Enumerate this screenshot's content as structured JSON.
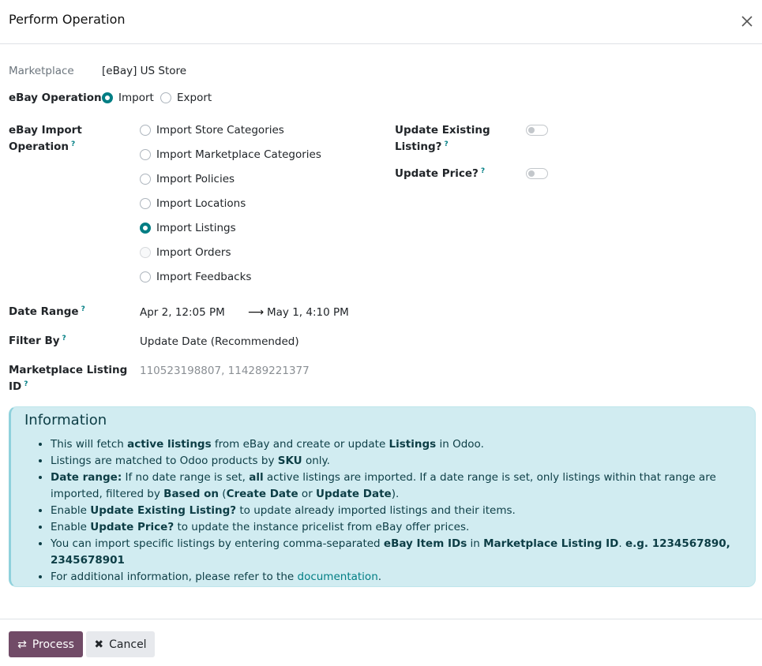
{
  "dialog": {
    "title": "Perform Operation",
    "close_icon": "close-icon"
  },
  "fields": {
    "marketplace_label": "Marketplace",
    "marketplace_value": "[eBay] US Store",
    "operation_label": "eBay Operation",
    "operation_options": [
      "Import",
      "Export"
    ],
    "operation_selected": "Import",
    "import_operation_label_line1": "eBay Import",
    "import_operation_label_line2": "Operation",
    "import_options": [
      "Import Store Categories",
      "Import Marketplace Categories",
      "Import Policies",
      "Import Locations",
      "Import Listings",
      "Import Orders",
      "Import Feedbacks"
    ],
    "import_selected": "Import Listings",
    "update_existing_label_line1": "Update Existing",
    "update_existing_label_line2": "Listing?",
    "update_existing_value": false,
    "update_price_label": "Update Price?",
    "update_price_value": false,
    "date_range_label": "Date Range",
    "date_start": "Apr 2, 12:05 PM",
    "date_end": "May 1, 4:10 PM",
    "filter_by_label": "Filter By",
    "filter_by_value": "Update Date (Recommended)",
    "listing_id_label_line1": "Marketplace Listing",
    "listing_id_label_line2": "ID",
    "listing_id_placeholder": "110523198807, 114289221377",
    "help_mark": "?"
  },
  "info": {
    "title": "Information",
    "items": [
      [
        "This will fetch ",
        "active listings",
        " from eBay and create or update ",
        "Listings",
        " in Odoo."
      ],
      [
        "Listings are matched to Odoo products by ",
        "SKU",
        " only."
      ],
      [
        "Date range:",
        " If no date range is set, ",
        "all",
        " active listings are imported. If a date range is set, only listings within that range are imported, filtered by ",
        "Based on",
        " (",
        "Create Date",
        " or ",
        "Update Date",
        ")."
      ],
      [
        "Enable ",
        "Update Existing Listing?",
        " to update already imported listings and their items."
      ],
      [
        "Enable ",
        "Update Price?",
        " to update the instance pricelist from eBay offer prices."
      ],
      [
        "You can import specific listings by entering comma-separated ",
        "eBay Item IDs",
        " in ",
        "Marketplace Listing ID",
        ". ",
        "e.g. 1234567890, 2345678901"
      ],
      [
        "For additional information, please refer to the ",
        "documentation",
        "."
      ]
    ]
  },
  "footer": {
    "process_label": "Process",
    "cancel_label": "Cancel"
  },
  "colors": {
    "primary": "#714b67",
    "accent": "#017e84",
    "info_bg": "#d1ecf1"
  }
}
